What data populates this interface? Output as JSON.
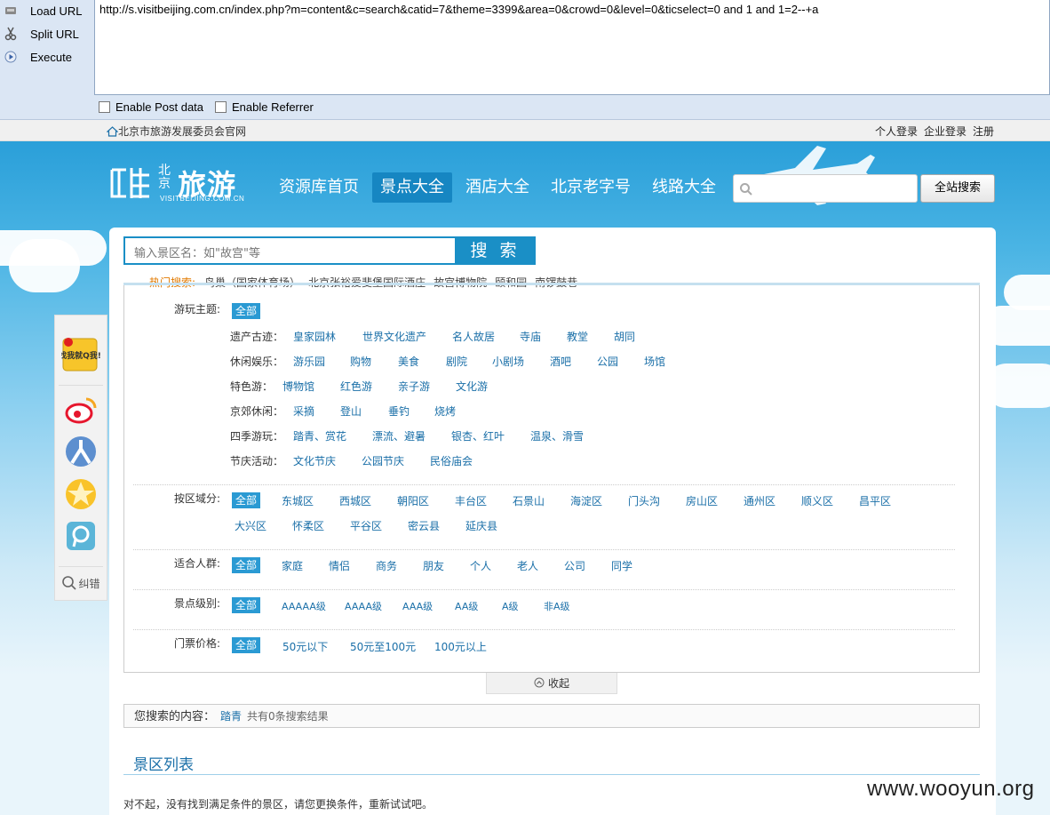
{
  "hackbar": {
    "load_url": "Load URL",
    "split_url": "Split URL",
    "execute": "Execute",
    "url_value": "http://s.visitbeijing.com.cn/index.php?m=content&c=search&catid=7&theme=3399&area=0&crowd=0&level=0&ticselect=0 and 1 and  1=2--+a",
    "enable_post": "Enable Post data",
    "enable_referrer": "Enable Referrer"
  },
  "topbar": {
    "home_link": "北京市旅游发展委员会官网",
    "personal_login": "个人登录",
    "enterprise_login": "企业登录",
    "register": "注册"
  },
  "header": {
    "logo_big": "旅游",
    "logo_bj": "北京",
    "logo_sub": "VISITBEIJING.COM.CN",
    "nav": [
      "资源库首页",
      "景点大全",
      "酒店大全",
      "北京老字号",
      "线路大全"
    ],
    "active_nav": "景点大全",
    "site_search_button": "全站搜索"
  },
  "search": {
    "placeholder": "输入景区名：如\"故宫\"等",
    "button": "搜 索",
    "hot_label": "热门搜索:",
    "hot_keywords": [
      "鸟巢（国家体育场）",
      "北京张裕爱斐堡国际酒庄",
      "故宫博物院",
      "颐和园",
      "南锣鼓巷"
    ]
  },
  "filters": {
    "theme": {
      "label": "游玩主题:",
      "all": "全部",
      "groups": [
        {
          "label": "遗产古迹：",
          "options": [
            "皇家园林",
            "世界文化遗产",
            "名人故居",
            "寺庙",
            "教堂",
            "胡同"
          ]
        },
        {
          "label": "休闲娱乐：",
          "options": [
            "游乐园",
            "购物",
            "美食",
            "剧院",
            "小剧场",
            "酒吧",
            "公园",
            "场馆"
          ]
        },
        {
          "label": "特色游：",
          "options": [
            "博物馆",
            "红色游",
            "亲子游",
            "文化游"
          ]
        },
        {
          "label": "京郊休闲：",
          "options": [
            "采摘",
            "登山",
            "垂钓",
            "烧烤"
          ]
        },
        {
          "label": "四季游玩：",
          "options": [
            "踏青、赏花",
            "漂流、避暑",
            "银杏、红叶",
            "温泉、滑雪"
          ]
        },
        {
          "label": "节庆活动：",
          "options": [
            "文化节庆",
            "公园节庆",
            "民俗庙会"
          ]
        }
      ]
    },
    "area": {
      "label": "按区域分:",
      "all": "全部",
      "options": [
        "东城区",
        "西城区",
        "朝阳区",
        "丰台区",
        "石景山",
        "海淀区",
        "门头沟",
        "房山区",
        "通州区",
        "顺义区",
        "昌平区",
        "大兴区",
        "怀柔区",
        "平谷区",
        "密云县",
        "延庆县"
      ]
    },
    "crowd": {
      "label": "适合人群:",
      "all": "全部",
      "options": [
        "家庭",
        "情侣",
        "商务",
        "朋友",
        "个人",
        "老人",
        "公司",
        "同学"
      ]
    },
    "level": {
      "label": "景点级别:",
      "all": "全部",
      "options": [
        "AAAAA级",
        "AAAA级",
        "AAA级",
        "AA级",
        "A级",
        "非A级"
      ]
    },
    "ticket": {
      "label": "门票价格:",
      "all": "全部",
      "options": [
        "50元以下",
        "50元至100元",
        "100元以上"
      ]
    }
  },
  "collapse_label": "收起",
  "result": {
    "label": "您搜索的内容：",
    "keyword": "踏青",
    "count_text": "共有0条搜索结果"
  },
  "list": {
    "title": "景区列表",
    "empty_text": "对不起，没有找到满足条件的景区，请您更换条件，重新试试吧。"
  },
  "sidebar": {
    "find_label": "找我就Q我!",
    "report_label": "纠错"
  },
  "watermark": "www.wooyun.org",
  "colors": {
    "brand_blue": "#1a8fc6",
    "hot_orange": "#e27a00",
    "link_blue": "#1a6fa8"
  }
}
